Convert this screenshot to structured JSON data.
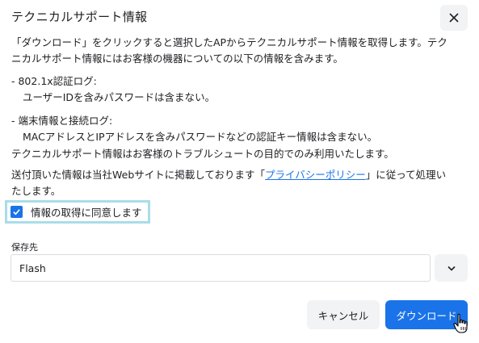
{
  "dialog": {
    "title": "テクニカルサポート情報",
    "close_icon": "close-icon"
  },
  "body": {
    "intro_line1": "「ダウンロード」をクリックすると選択したAPからテクニカルサポート情報を取得します。テク",
    "intro_line2": "ニカルサポート情報にはお客様の機器についての以下の情報を含みます。",
    "item1_head": "- 802.1x認証ログ:",
    "item1_detail": "ユーザーIDを含みパスワードは含まない。",
    "item2_head": "- 端末情報と接続ログ:",
    "item2_detail": "MACアドレスとIPアドレスを含みパスワードなどの認証キー情報は含まない。",
    "usage": "テクニカルサポート情報はお客様のトラブルシュートの目的でのみ利用いたします。",
    "privacy_before": "送付頂いた情報は当社Webサイトに掲載しております「",
    "privacy_link": "プライバシーポリシー",
    "privacy_after": "」に従って処理い",
    "privacy_line2": "たします。"
  },
  "consent": {
    "checked": true,
    "label": "情報の取得に同意します"
  },
  "save": {
    "label": "保存先",
    "value": "Flash"
  },
  "buttons": {
    "cancel": "キャンセル",
    "download": "ダウンロード"
  },
  "colors": {
    "accent": "#1a73e8",
    "highlight_border": "#a8dde9",
    "button_bg": "#f1f3f4"
  }
}
